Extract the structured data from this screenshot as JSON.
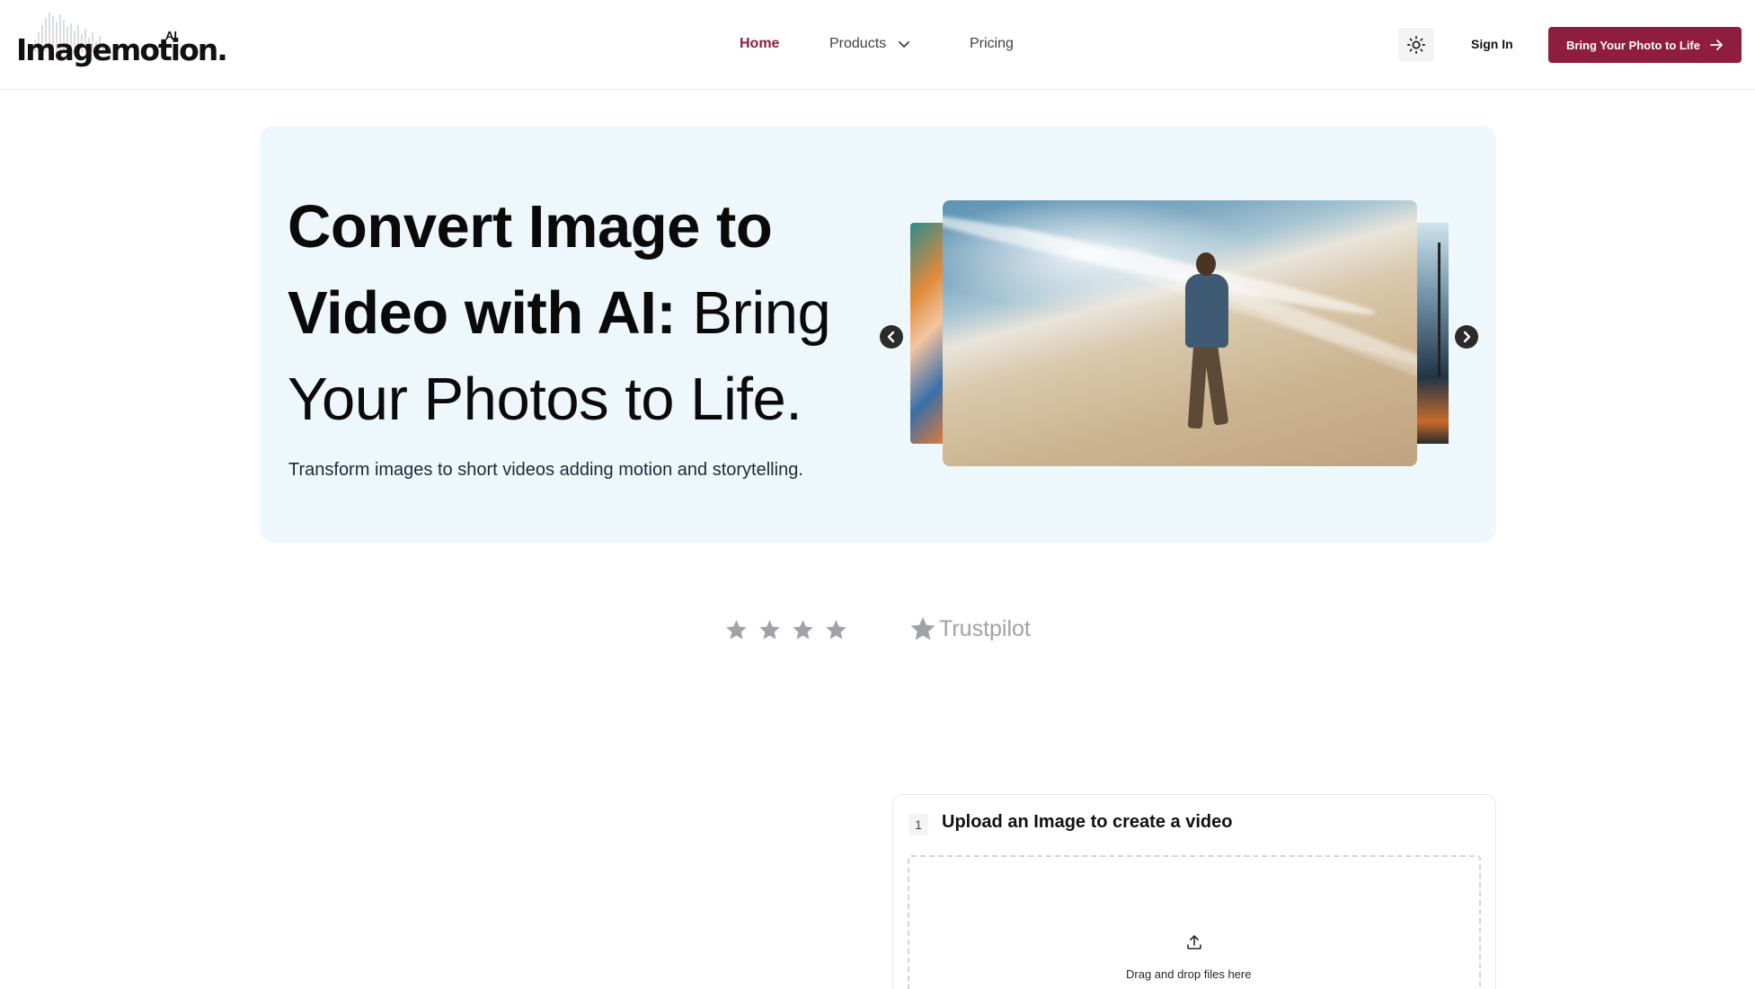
{
  "brand": {
    "name": "Imagemotion.",
    "suffix": "AI"
  },
  "nav": {
    "home": "Home",
    "products": "Products",
    "pricing": "Pricing"
  },
  "header": {
    "sign_in": "Sign In",
    "cta_label": "Bring Your Photo to Life",
    "theme_icon": "sun-icon"
  },
  "hero": {
    "title_strong": "Convert Image to Video with AI:",
    "title_light": "Bring Your Photos to Life.",
    "subtitle": "Transform images to short videos adding motion and storytelling."
  },
  "rating": {
    "stars_shown": 4,
    "platform": "Trustpilot"
  },
  "upload": {
    "step": "1",
    "title": "Upload an Image to create a video",
    "drop_text": "Drag and drop files here"
  },
  "colors": {
    "accent": "#8e1d3f",
    "hero_bg": "#eef7fc",
    "muted": "#a1a1aa"
  }
}
